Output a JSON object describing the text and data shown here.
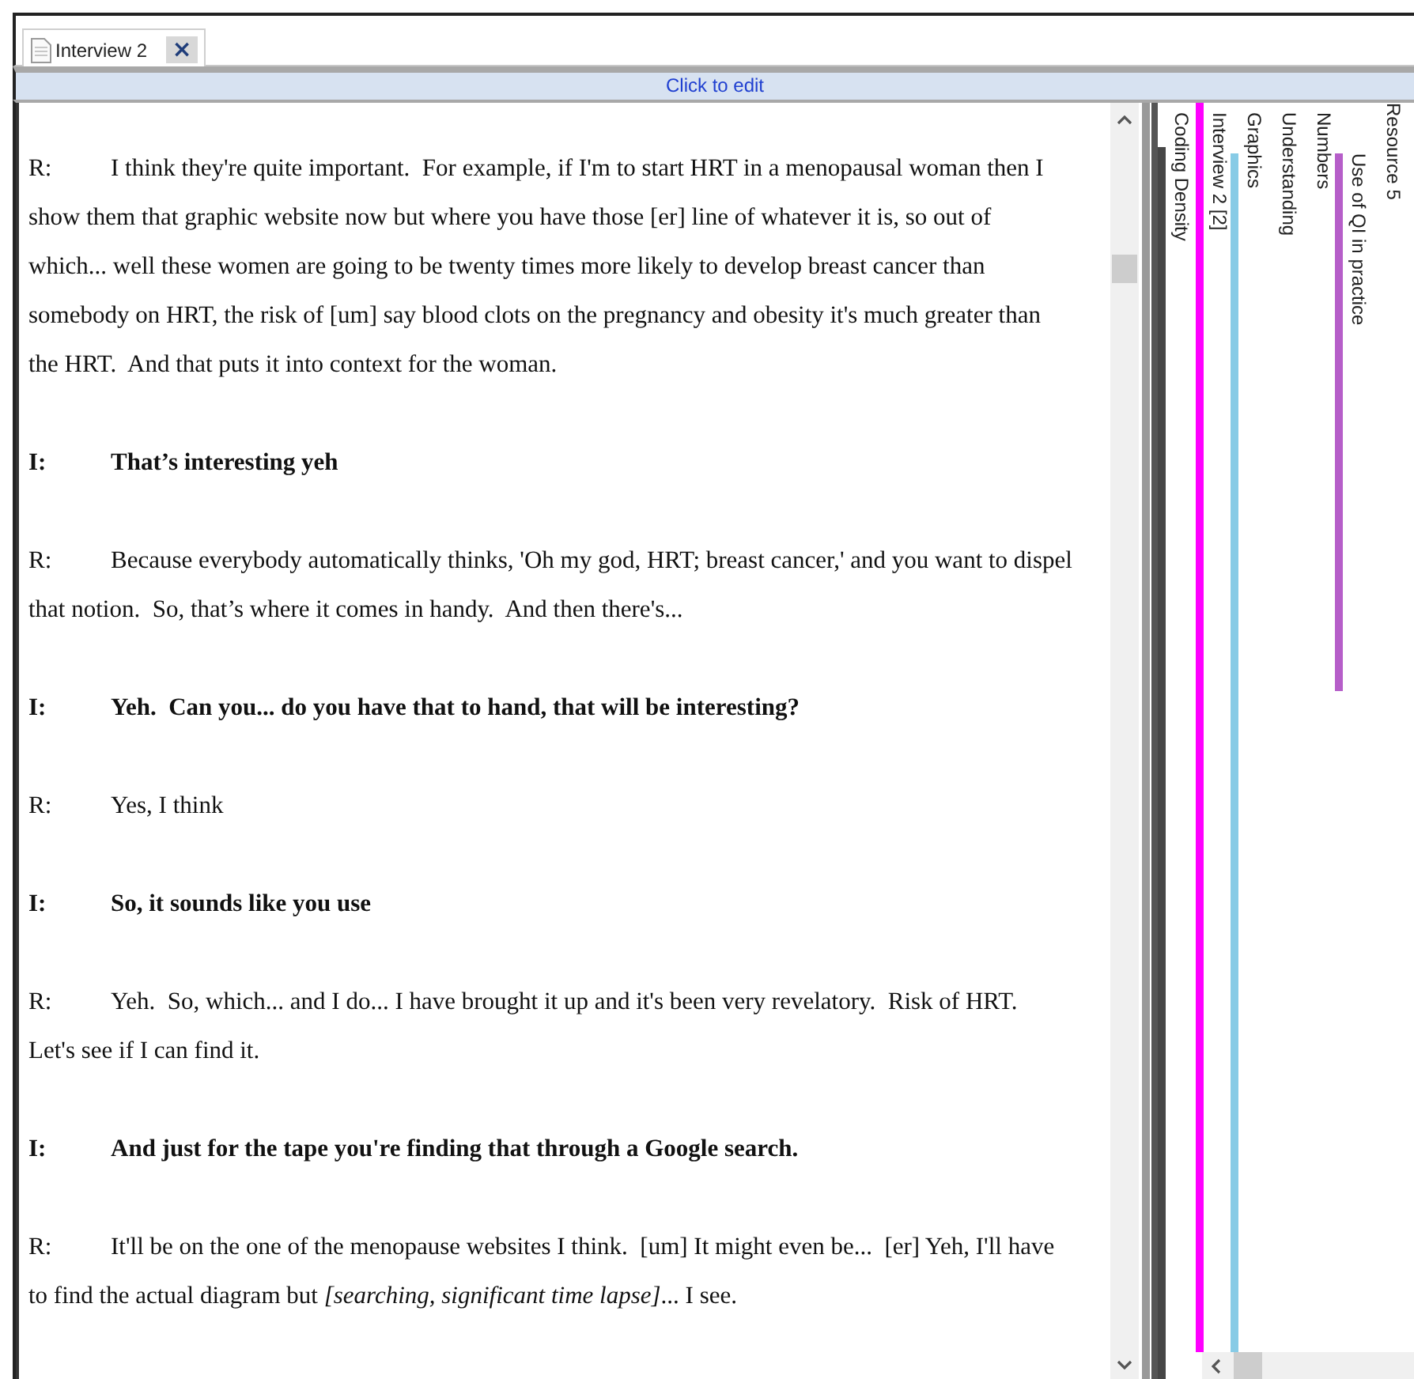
{
  "tab": {
    "label": "Interview 2",
    "close": "×",
    "selected": true
  },
  "edit_bar": {
    "label": "Click to edit"
  },
  "transcript": [
    {
      "speaker": "R:",
      "kind": "respondent",
      "text": "I think they're quite important.  For example, if I'm to start HRT in a menopausal woman then I show them that graphic website now but where you have those [er] line of whatever it is, so out of which... well these women are going to be twenty times more likely to develop breast cancer than somebody on HRT, the risk of [um] say blood clots on the pregnancy and obesity it's much greater than the HRT.  And that puts it into context for the woman."
    },
    {
      "speaker": "I:",
      "kind": "interviewer",
      "text": "That’s interesting yeh"
    },
    {
      "speaker": "R:",
      "kind": "respondent",
      "text": "Because everybody automatically thinks, 'Oh my god, HRT; breast cancer,' and you want to dispel that notion.  So, that’s where it comes in handy.  And then there's..."
    },
    {
      "speaker": "I:",
      "kind": "interviewer",
      "text": "Yeh.  Can you... do you have that to hand, that will be interesting?"
    },
    {
      "speaker": "R:",
      "kind": "respondent",
      "text": "Yes, I think"
    },
    {
      "speaker": "I:",
      "kind": "interviewer",
      "text": "So, it sounds like you use"
    },
    {
      "speaker": "R:",
      "kind": "respondent",
      "text": "Yeh.  So, which... and I do... I have brought it up and it's been very revelatory.  Risk of HRT.  Let's see if I can find it."
    },
    {
      "speaker": "I:",
      "kind": "interviewer",
      "text": "And just for the tape you're finding that through a Google search."
    },
    {
      "speaker": "R:",
      "kind": "respondent",
      "text": "It'll be on the one of the menopause websites I think.  [um] It might even be...  [er] Yeh, I'll have to find the actual diagram but *[searching, significant time lapse]*... I see."
    }
  ],
  "coding_stripes": [
    {
      "label": "Coding Density",
      "kind": "density",
      "color": "#464646"
    },
    {
      "label": "Interview 2 [2]",
      "kind": "full",
      "color": "#ff00ff"
    },
    {
      "label": "Graphics",
      "kind": "full",
      "color": "#87cbe6"
    },
    {
      "label": "Understanding",
      "kind": "none"
    },
    {
      "label": "Numbers",
      "kind": "none"
    },
    {
      "label": "Use of QI in practice",
      "kind": "partial",
      "color": "#b65ec9"
    },
    {
      "label": "Resource 5",
      "kind": "cut"
    }
  ]
}
